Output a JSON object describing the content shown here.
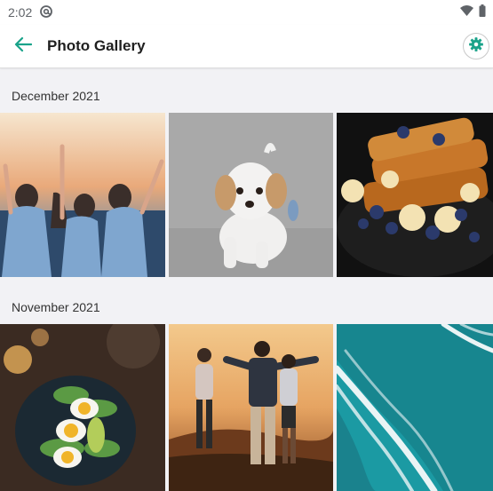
{
  "status_bar": {
    "time": "2:02",
    "icons": [
      "at-sign-icon",
      "wifi-icon",
      "battery-icon"
    ]
  },
  "app_bar": {
    "title": "Photo Gallery",
    "back_icon": "arrow-left-icon",
    "settings_icon": "gear-icon",
    "accent_color": "#1aa38a"
  },
  "sections": [
    {
      "title": "December 2021",
      "photos": [
        {
          "subject": "group-of-friends-sunset"
        },
        {
          "subject": "puppy-on-grey-background"
        },
        {
          "subject": "french-toast-with-berries"
        }
      ]
    },
    {
      "title": "November 2021",
      "photos": [
        {
          "subject": "plate-of-eggs-and-avocado"
        },
        {
          "subject": "friends-silhouette-sunset"
        },
        {
          "subject": "aerial-ocean-waves"
        }
      ]
    }
  ]
}
